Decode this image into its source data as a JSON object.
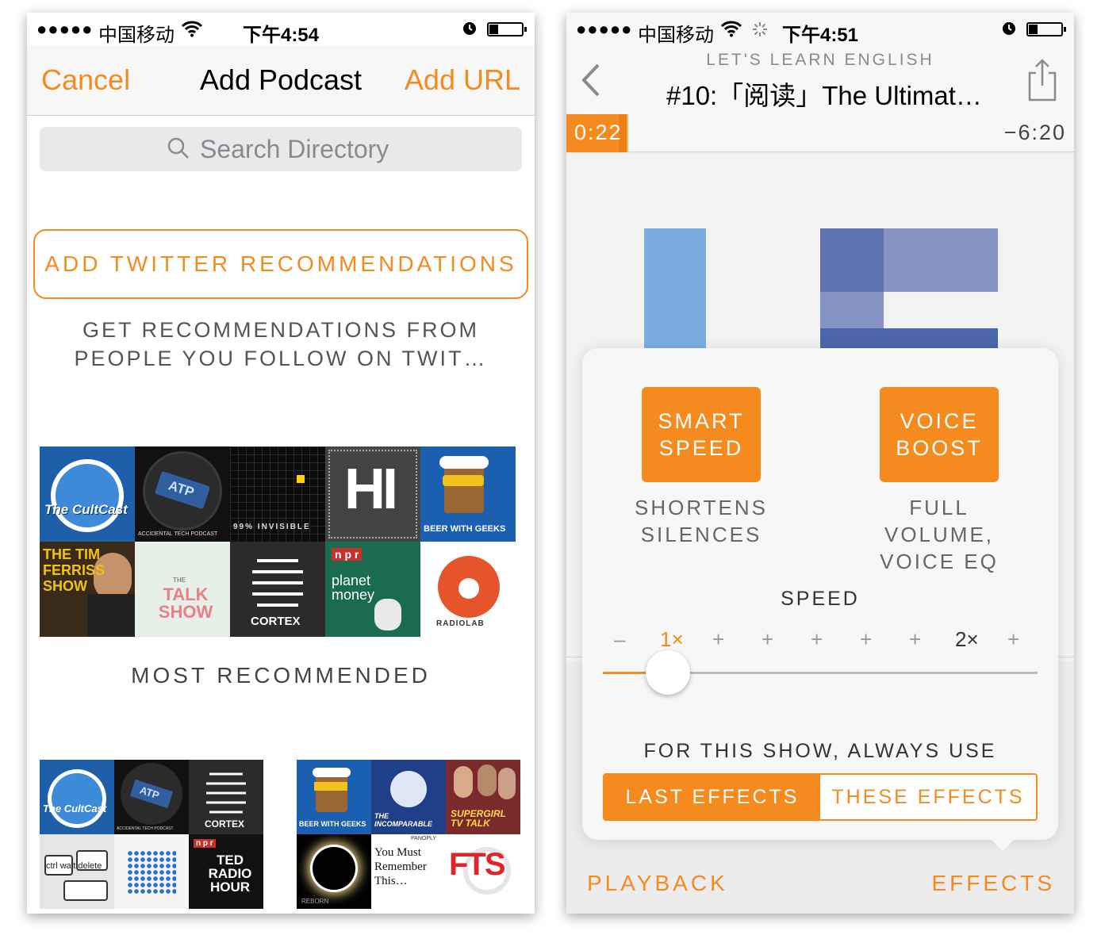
{
  "left_screen": {
    "status_bar": {
      "signal": "●●●●●",
      "carrier": "中国移动",
      "time": "下午4:54"
    },
    "nav": {
      "cancel": "Cancel",
      "title": "Add Podcast",
      "add_url": "Add URL"
    },
    "search": {
      "placeholder": "Search Directory"
    },
    "twitter_button": "ADD TWITTER RECOMMENDATIONS",
    "twitter_desc_line1": "GET RECOMMENDATIONS FROM",
    "twitter_desc_line2": "PEOPLE YOU FOLLOW ON TWIT…",
    "grid_big": [
      {
        "label": "The CultCast"
      },
      {
        "label": "ATP",
        "sub": "ACCIDENTAL TECH PODCAST"
      },
      {
        "label": "99% INVISIBLE"
      },
      {
        "label": "HI"
      },
      {
        "label": "BEER WITH GEEKS"
      },
      {
        "label": "THE TIM FERRISS SHOW"
      },
      {
        "label": "TALK SHOW",
        "pre": "THE"
      },
      {
        "label": "CORTEX"
      },
      {
        "label": "planet money",
        "badge": "n p r"
      },
      {
        "label": "RADIOLAB"
      }
    ],
    "section_title": "MOST RECOMMENDED",
    "grid_small_a": [
      {
        "label": "The CultCast"
      },
      {
        "label": "ATP",
        "sub": "ACCIDENTAL TECH PODCAST"
      },
      {
        "label": "CORTEX"
      },
      {
        "label": "ctrl walt delete"
      },
      {
        "label": ""
      },
      {
        "label": "TED RADIO HOUR",
        "badge": "n p r"
      }
    ],
    "grid_small_b": [
      {
        "label": "BEER WITH GEEKS"
      },
      {
        "label": "THE INCOMPARABLE"
      },
      {
        "label": "SUPERGIRL TV TALK"
      },
      {
        "label": "REBORN"
      },
      {
        "label": "You Must Remember This…",
        "pre": "PANOPLY"
      },
      {
        "label": "FTS"
      }
    ]
  },
  "right_screen": {
    "status_bar": {
      "signal": "●●●●●",
      "carrier": "中国移动",
      "time": "下午4:51"
    },
    "show_name": "LET'S LEARN ENGLISH",
    "episode_title": "#10:「阅读」The Ultimat…",
    "elapsed": "0:22",
    "remaining": "−6:20",
    "progress_fraction": 0.056,
    "effects": {
      "smart_speed_line1": "SMART",
      "smart_speed_line2": "SPEED",
      "smart_speed_desc1": "SHORTENS",
      "smart_speed_desc2": "SILENCES",
      "voice_boost_line1": "VOICE",
      "voice_boost_line2": "BOOST",
      "voice_boost_desc1": "FULL",
      "voice_boost_desc2": "VOLUME,",
      "voice_boost_desc3": "VOICE EQ",
      "speed_label": "SPEED",
      "ticks": [
        "–",
        "1×",
        "+",
        "+",
        "+",
        "+",
        "+",
        "2×",
        "+"
      ],
      "speed_value": 1,
      "always_use_label": "FOR THIS SHOW, ALWAYS USE",
      "last_effects": "LAST EFFECTS",
      "these_effects": "THESE EFFECTS"
    },
    "tabs": {
      "playback": "PLAYBACK",
      "effects": "EFFECTS"
    }
  },
  "colors": {
    "accent": "#f58a1f",
    "accent_dark": "#ef7f14"
  }
}
